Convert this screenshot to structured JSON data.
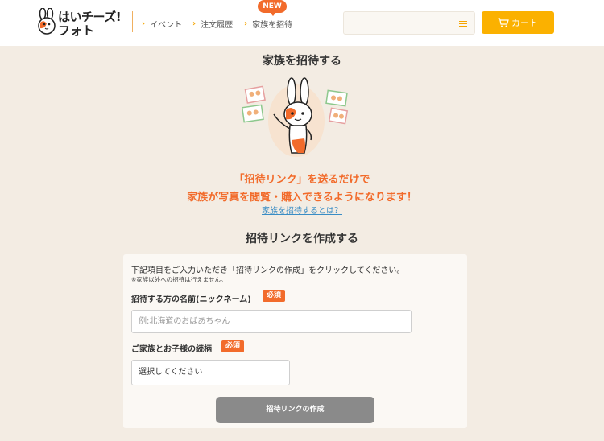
{
  "header": {
    "logo_line1": "はいチーズ!",
    "logo_line2": "フォト",
    "nav": [
      {
        "label": "イベント"
      },
      {
        "label": "注文履歴"
      },
      {
        "label": "家族を招待"
      }
    ],
    "new_badge": "NEW",
    "search_placeholder": "",
    "cart_label": "カート"
  },
  "main": {
    "title": "家族を招待する",
    "lead_line1": "「招待リンク」を送るだけで",
    "lead_line2": "家族が写真を閲覧・購入できるようになります！",
    "what_link": "家族を招待するとは？",
    "form_title": "招待リンクを作成する",
    "instruction": "下記項目をご入力いただき「招待リンクの作成」をクリックしてください。",
    "note": "※家族以外への招待は行えません。",
    "name_label": "招待する方の名前(ニックネーム)",
    "required_label": "必須",
    "name_placeholder": "例:北海道のおばあちゃん",
    "relation_label": "ご家族とお子様の続柄",
    "relation_value": "選択してください",
    "create_button": "招待リンクの作成"
  },
  "colors": {
    "accent_orange": "#f26b2b",
    "cart_yellow": "#fbb100",
    "background": "#f3ece3"
  }
}
